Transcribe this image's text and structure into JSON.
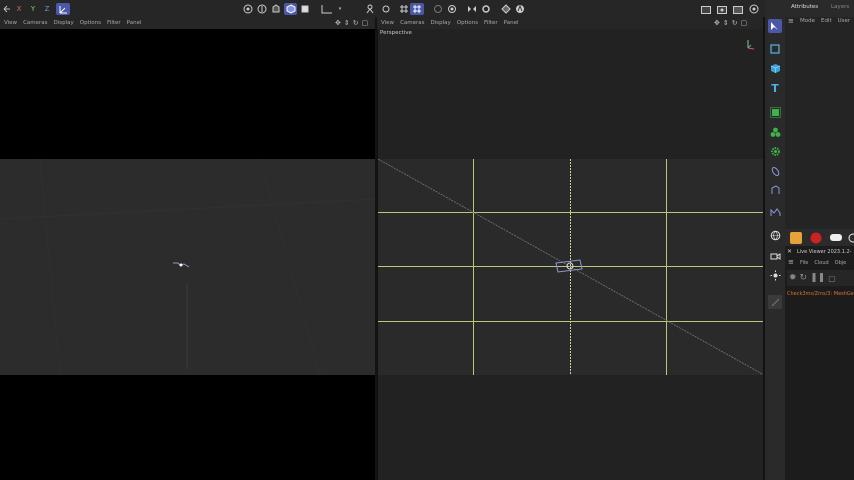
{
  "toolbar": {
    "x_label": "X",
    "y_label": "Y",
    "z_label": "Z",
    "icons": [
      "undo-icon",
      "redo-icon",
      "x-axis-lock",
      "y-axis-lock",
      "z-axis-lock",
      "coordinate-system-icon",
      "render-region-icon",
      "render-view-icon",
      "render-settings-icon",
      "object-mode-icon",
      "model-mode-icon",
      "point-mode-icon",
      "edge-mode-icon",
      "polygon-mode-icon",
      "snap-icon",
      "workplane-icon",
      "grid-icon",
      "axis-icon",
      "symmetry-icon",
      "lock-icon",
      "render-icon",
      "render-queue-icon",
      "picture-viewer-icon",
      "camera-icon"
    ]
  },
  "left_viewport": {
    "menu": [
      "View",
      "Cameras",
      "Display",
      "Options",
      "Filter",
      "Panel"
    ]
  },
  "right_viewport": {
    "menu": [
      "View",
      "Cameras",
      "Display",
      "Options",
      "Filter",
      "Panel"
    ],
    "label": "Perspective"
  },
  "attributes": {
    "tabs": [
      "Attributes",
      "Layers"
    ],
    "menu": [
      "Mode",
      "Edit",
      "User"
    ]
  },
  "live_viewer": {
    "title": "Live Viewer 2023.1.2-",
    "menu": [
      "File",
      "Cloud",
      "Obje"
    ],
    "status": "Check3ms/Zms/3: MeshGe"
  },
  "colors": {
    "accent": "#4b57a8",
    "grid_line": "#b7c97a",
    "status_orange": "#d8772b"
  }
}
